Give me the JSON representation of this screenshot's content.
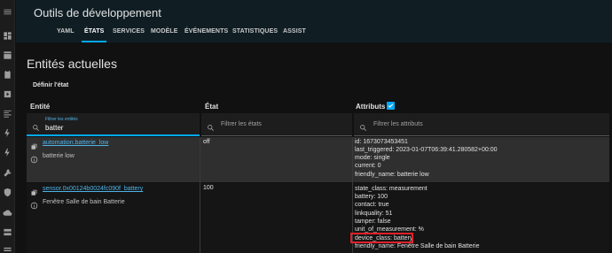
{
  "header": {
    "title": "Outils de développement",
    "tabs": [
      {
        "label": "YAML",
        "active": false
      },
      {
        "label": "ÉTATS",
        "active": true
      },
      {
        "label": "SERVICES",
        "active": false
      },
      {
        "label": "MODÈLE",
        "active": false
      },
      {
        "label": "ÉVÉNEMENTS",
        "active": false
      },
      {
        "label": "STATISTIQUES",
        "active": false
      },
      {
        "label": "ASSIST",
        "active": false
      }
    ]
  },
  "sidebar": {
    "icons": [
      "dashboard-icon",
      "dashboard-2-icon",
      "calendar-icon",
      "media-icon",
      "history-icon",
      "energy-icon",
      "energy-2-icon",
      "tools-icon",
      "shield-icon",
      "cloud-icon",
      "server-icon"
    ]
  },
  "main": {
    "title": "Entités actuelles",
    "set_state_label": "Définir l'état",
    "columns": {
      "entity": "Entité",
      "state": "État",
      "attributes": "Attributs"
    },
    "attributes_checkbox_checked": true,
    "filters": {
      "entity_label": "Filtrer les entités",
      "entity_value": "batter",
      "state_placeholder": "Filtrer les états",
      "attributes_placeholder": "Filtrer les attributs"
    },
    "rows": [
      {
        "entity_id": "automation.batterie_low",
        "friendly_name": "batterie low",
        "state": "off",
        "attributes": [
          "id: 1673073453451",
          "last_triggered: 2023-01-07T06:39:41.280582+00:00",
          "mode: single",
          "current: 0",
          "friendly_name: batterie low"
        ]
      },
      {
        "entity_id": "sensor.0x00124b0024fc090f_battery",
        "friendly_name": "Fenêtre Salle de bain Batterie",
        "state": "100",
        "attributes": [
          "state_class: measurement",
          "battery: 100",
          "contact: true",
          "linkquality: 51",
          "tamper: false",
          "unit_of_measurement: %",
          "device_class: battery",
          "friendly_name: Fenêtre Salle de bain Batterie"
        ]
      }
    ]
  },
  "colors": {
    "accent": "#03a9f4",
    "header_bg": "#101e24",
    "highlight": "#e0202a"
  }
}
